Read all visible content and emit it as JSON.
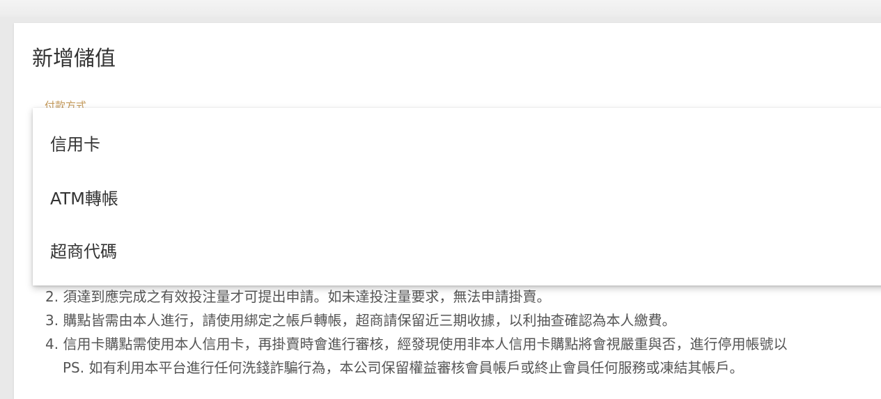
{
  "page": {
    "title": "新增儲值"
  },
  "payment_field": {
    "label": "付款方式"
  },
  "dropdown": {
    "options": [
      "信用卡",
      "ATM轉帳",
      "超商代碼"
    ]
  },
  "notes": [
    "2. 須達到應完成之有效投注量才可提出申請。如未達投注量要求，無法申請掛賣。",
    "3. 購點皆需由本人進行，請使用綁定之帳戶轉帳，超商請保留近三期收據，以利抽查確認為本人繳費。",
    "4. 信用卡購點需使用本人信用卡，再掛賣時會進行審核，經發現使用非本人信用卡購點將會視嚴重與否，進行停用帳號以",
    "PS. 如有利用本平台進行任何洗錢詐騙行為，本公司保留權益審核會員帳戶或終止會員任何服務或凍結其帳戶。"
  ]
}
